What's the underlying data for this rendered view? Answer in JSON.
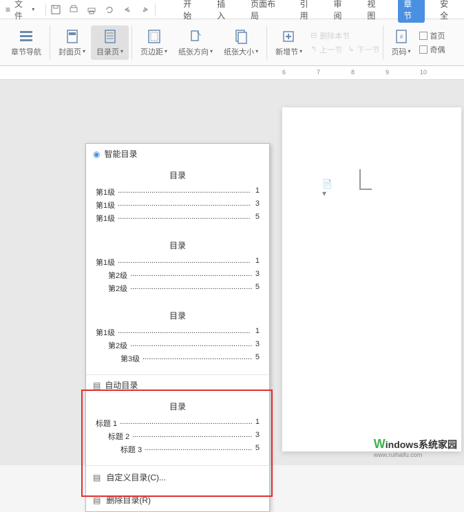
{
  "topmenu": {
    "file_label": "文件"
  },
  "tabs": {
    "start": "开始",
    "insert": "插入",
    "page_layout": "页面布局",
    "reference": "引用",
    "review": "审阅",
    "view": "视图",
    "section": "章节",
    "security": "安全"
  },
  "ribbon": {
    "section_nav": "章节导航",
    "cover": "封面页",
    "toc_page": "目录页",
    "margin": "页边距",
    "orientation": "纸张方向",
    "paper_size": "纸张大小",
    "new_section": "新增节",
    "delete_section": "删除本节",
    "prev_section": "上一节",
    "next_section": "下一节",
    "page_number": "页码",
    "first_page": "首页",
    "odd_even": "奇偶"
  },
  "ruler": {
    "m6": "6",
    "m7": "7",
    "m8": "8",
    "m9": "9",
    "m10": "10"
  },
  "panel": {
    "smart_toc": "智能目录",
    "auto_toc": "自动目录",
    "custom_toc": "自定义目录(C)...",
    "delete_toc": "删除目录(R)",
    "toc_label": "目录",
    "preview1": {
      "l1": "第1级",
      "p1": "1",
      "l2": "第1级",
      "p2": "3",
      "l3": "第1级",
      "p3": "5"
    },
    "preview2": {
      "l1": "第1级",
      "p1": "1",
      "l2a": "第2级",
      "p2a": "3",
      "l2b": "第2级",
      "p2b": "5"
    },
    "preview3": {
      "l1": "第1级",
      "p1": "1",
      "l2": "第2级",
      "p2": "3",
      "l3": "第3级",
      "p3": "5"
    },
    "auto_preview": {
      "l1": "标题 1",
      "p1": "1",
      "l2": "标题 2",
      "p2": "3",
      "l3": "标题 3",
      "p3": "5"
    }
  },
  "watermark": {
    "url": "www.ruihaifu.com"
  },
  "brand": {
    "text": "indows系统家园"
  },
  "dots": "..............................................................."
}
